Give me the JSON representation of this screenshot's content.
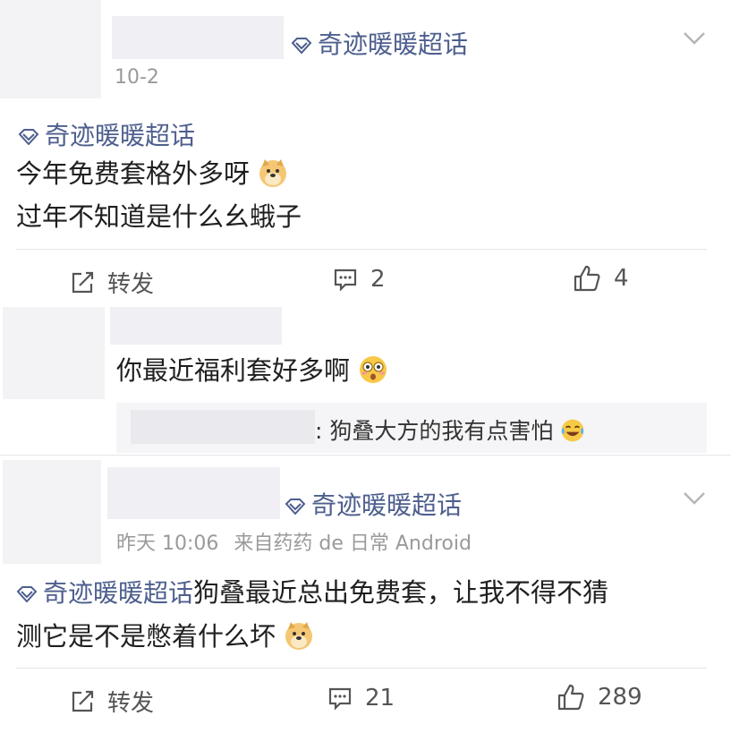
{
  "post1": {
    "topic": "奇迹暖暖超话",
    "date": "10-2",
    "inline_topic": "奇迹暖暖超话",
    "line1": "今年免费套格外多呀",
    "line2": "过年不知道是什么幺蛾子",
    "repost_label": "转发",
    "comment_count": "2",
    "like_count": "4"
  },
  "comment": {
    "text": "你最近福利套好多啊",
    "reply_text": ": 狗叠大方的我有点害怕"
  },
  "post2": {
    "topic": "奇迹暖暖超话",
    "time": "昨天 10:06",
    "source": "来自药药 de 日常 Android",
    "inline_topic": "奇迹暖暖超话",
    "line1_rest": "狗叠最近总出免费套，让我不得不猜",
    "line2": "测它是不是憋着什么坏",
    "repost_label": "转发",
    "comment_count": "21",
    "like_count": "289"
  },
  "icons": {
    "topic": "super-topic-diamond-icon",
    "chevron": "chevron-down-icon",
    "repost": "repost-icon",
    "comment": "comment-icon",
    "like": "thumbs-up-icon",
    "doge": "doge-emoji",
    "flushed": "flushed-emoji",
    "laugh_cry": "laughing-crying-emoji"
  },
  "colors": {
    "topic": "#4e5f8e",
    "meta": "#9a9a9a",
    "placeholder": "#f0f0f4"
  }
}
